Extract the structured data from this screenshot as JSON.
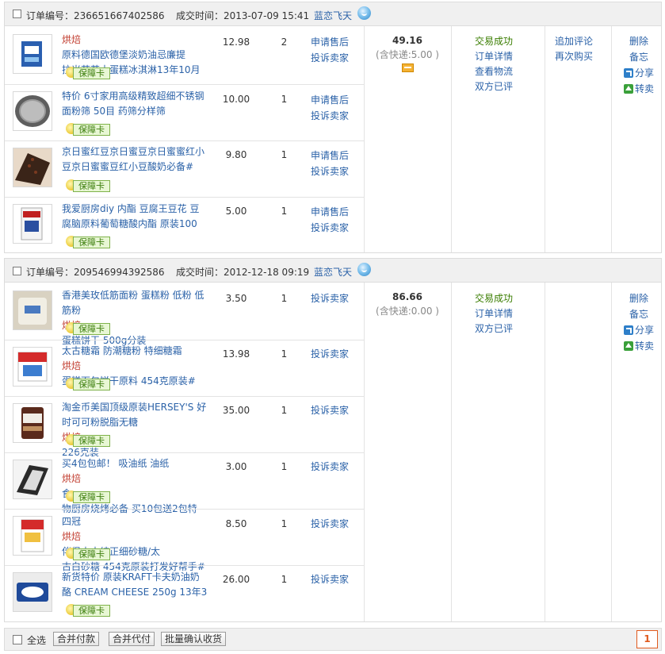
{
  "orders": [
    {
      "order_no": "订单编号：236651667402586",
      "deal_time": "成交时间：2013-07-09 15:41",
      "seller": "蓝恋飞天",
      "total": "49.16",
      "shipping": "(含快递:5.00 )",
      "status": "交易成功",
      "status_links": [
        "订单详情",
        "查看物流",
        "双方已评"
      ],
      "extra_links": [
        "追加评论",
        "再次购买"
      ],
      "right": {
        "delete": "删除",
        "memo": "备忘",
        "share": "分享",
        "resell": "转卖"
      },
      "items": [
        {
          "name": [
            "原料德国欧德堡淡奶油忌廉提",
            "拉米苏芝士蛋糕冰淇淋13年10月"
          ],
          "bake_prefix": "烘焙",
          "price": "12.98",
          "qty": "2",
          "actions": [
            "申请售后",
            "投诉卖家"
          ],
          "badge": "保障卡"
        },
        {
          "name": [
            "特价 6寸家用高级精致超细不锈钢",
            "面粉筛 50目 药筛分样筛"
          ],
          "price": "10.00",
          "qty": "1",
          "actions": [
            "申请售后",
            "投诉卖家"
          ],
          "badge": "保障卡"
        },
        {
          "name": [
            "京日蜜红豆京日蜜豆京日蜜蜜红小",
            "豆京日蜜蜜豆红小豆酸奶必备#"
          ],
          "price": "9.80",
          "qty": "1",
          "actions": [
            "申请售后",
            "投诉卖家"
          ],
          "badge": "保障卡"
        },
        {
          "name": [
            "我爱厨房diy 内酯 豆腐王豆花 豆",
            "腐脑原料葡萄糖酸内酯 原装100"
          ],
          "price": "5.00",
          "qty": "1",
          "actions": [
            "申请售后",
            "投诉卖家"
          ],
          "badge": "保障卡"
        }
      ]
    },
    {
      "order_no": "订单编号：209546994392586",
      "deal_time": "成交时间：2012-12-18 09:19",
      "seller": "蓝恋飞天",
      "total": "86.66",
      "shipping": "(含快递:0.00 )",
      "status": "交易成功",
      "status_links": [
        "订单详情",
        "双方已评"
      ],
      "extra_links": [],
      "right": {
        "delete": "删除",
        "memo": "备忘",
        "share": "分享",
        "resell": "转卖"
      },
      "items": [
        {
          "name_rich": [
            [
              "香港美玫低筋面粉 蛋糕粉 低粉 低",
              null
            ],
            [
              "筋粉 ",
              "烘焙",
              "蛋糕饼干 500g分装"
            ]
          ],
          "price": "3.50",
          "qty": "1",
          "actions": [
            "投诉卖家"
          ],
          "badge": "保障卡"
        },
        {
          "name_rich": [
            [
              "太古糖霜 防潮糖粉 特细糖霜 ",
              "烘焙",
              ""
            ],
            [
              "蛋糕面包饼干原料 454克原装#",
              null
            ]
          ],
          "price": "13.98",
          "qty": "1",
          "actions": [
            "投诉卖家"
          ],
          "badge": "保障卡"
        },
        {
          "name_rich": [
            [
              "淘金币美国顶级原装HERSEY'S 好",
              null
            ],
            [
              "时可可粉脱脂无糖 ",
              "烘焙",
              " 226克装"
            ]
          ],
          "price": "35.00",
          "qty": "1",
          "actions": [
            "投诉卖家"
          ],
          "badge": "保障卡"
        },
        {
          "name_rich": [
            [
              "买4包包邮！ 吸油纸 油纸 ",
              "烘焙",
              "食"
            ],
            [
              "物厨房烧烤必备 买10包送2包特",
              null
            ]
          ],
          "price": "3.00",
          "qty": "1",
          "actions": [
            "投诉卖家"
          ],
          "badge": "保障卡"
        },
        {
          "name_rich": [
            [
              "四冠 ",
              "烘焙",
              "伴侣太古纯正细砂糖/太"
            ],
            [
              "古白砂糖 454克原装打发好帮手#",
              null
            ]
          ],
          "price": "8.50",
          "qty": "1",
          "actions": [
            "投诉卖家"
          ],
          "badge": "保障卡"
        },
        {
          "name_rich": [
            [
              "新货特价 原装KRAFT卡夫奶油奶",
              null
            ],
            [
              "酪 CREAM CHEESE 250g 13年3",
              null
            ]
          ],
          "price": "26.00",
          "qty": "1",
          "actions": [
            "投诉卖家"
          ],
          "badge": "保障卡"
        }
      ]
    }
  ],
  "footer": {
    "select_all": "全选",
    "buttons": [
      "合并付款",
      "合并代付",
      "批量确认收货"
    ],
    "page": "1"
  },
  "colors": {
    "link": "#2b62a8",
    "success": "#3a7d00",
    "bake": "#c0392b",
    "page": "#e05a1e"
  }
}
